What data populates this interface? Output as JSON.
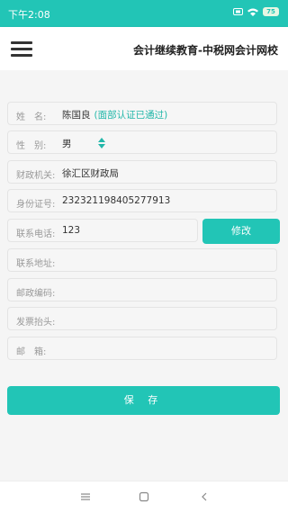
{
  "status_bar": {
    "time": "下午2:08",
    "battery": "75"
  },
  "header": {
    "title": "会计继续教育-中税网会计网校"
  },
  "form": {
    "name": {
      "label": "姓　名:",
      "value": "陈国良",
      "badge": "(面部认证已通过)"
    },
    "gender": {
      "label": "性　别:",
      "value": "男"
    },
    "finance_office": {
      "label": "财政机关:",
      "value": "徐汇区财政局"
    },
    "id_number": {
      "label": "身份证号:",
      "value": "232321198405277913"
    },
    "phone": {
      "label": "联系电话:",
      "value": "123"
    },
    "address": {
      "label": "联系地址:",
      "value": ""
    },
    "postcode": {
      "label": "邮政编码:",
      "value": ""
    },
    "invoice_title": {
      "label": "发票抬头:",
      "value": ""
    },
    "email": {
      "label": "邮　箱:",
      "value": ""
    }
  },
  "buttons": {
    "edit_label": "修改",
    "save_label": "保 存"
  },
  "colors": {
    "accent": "#22c5b6",
    "badge": "#22b7a9"
  },
  "icons": [
    "menu-icon",
    "wifi-icon",
    "battery-icon",
    "sort-icon",
    "nav-menu-icon",
    "nav-home-icon",
    "nav-back-icon"
  ]
}
